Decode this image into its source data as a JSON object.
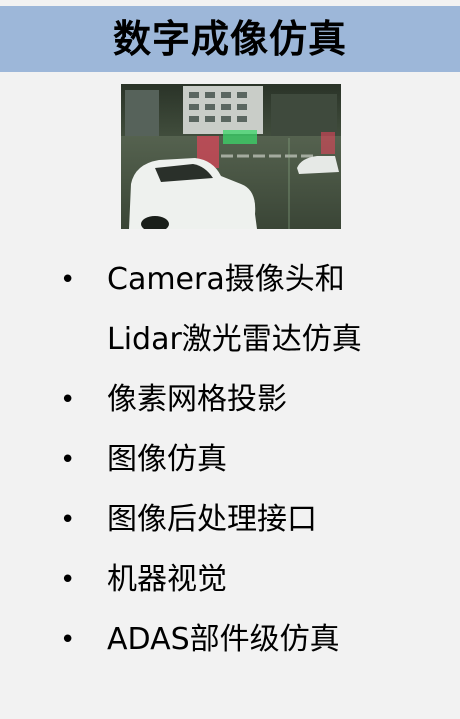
{
  "header": {
    "title": "数字成像仿真"
  },
  "illustration": {
    "icon": "driving-simulation-scene-image",
    "colors": {
      "sky": "#3b4a3a",
      "road": "#4a5848",
      "car": "#eef1ee",
      "green_box": "#3bd66a",
      "red_box": "#e0455a"
    }
  },
  "bullets": {
    "marker": "•",
    "items": [
      {
        "lines": [
          "Camera摄像头和",
          "Lidar激光雷达仿真"
        ]
      },
      {
        "lines": [
          "像素网格投影"
        ]
      },
      {
        "lines": [
          "图像仿真"
        ]
      },
      {
        "lines": [
          "图像后处理接口"
        ]
      },
      {
        "lines": [
          "机器视觉"
        ]
      },
      {
        "lines": [
          "ADAS部件级仿真"
        ]
      }
    ]
  }
}
